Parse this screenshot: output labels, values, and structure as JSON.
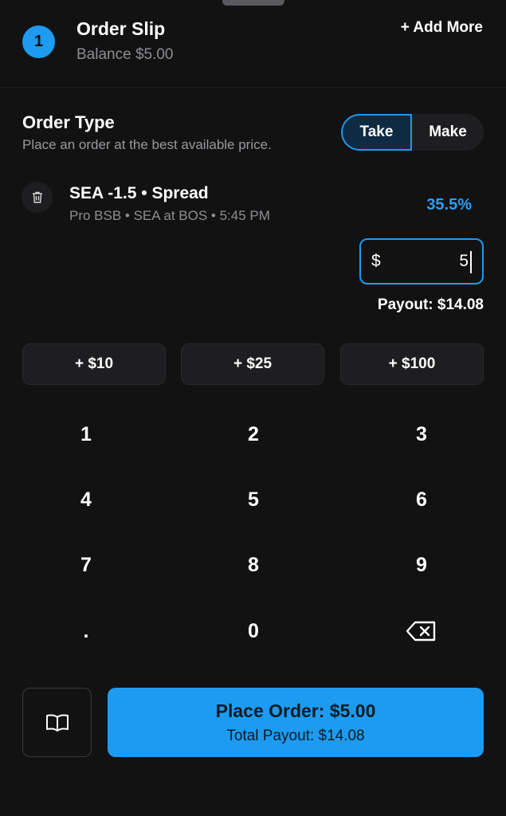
{
  "header": {
    "slip_count": "1",
    "title": "Order Slip",
    "balance": "Balance $5.00",
    "add_more": "+ Add More"
  },
  "order_type": {
    "title": "Order Type",
    "description": "Place an order at the best available price.",
    "options": [
      "Take",
      "Make"
    ],
    "selected": "Take"
  },
  "market": {
    "title": "SEA -1.5 • Spread",
    "subtitle": "Pro BSB • SEA at BOS • 5:45 PM",
    "odds": "35.5%",
    "delete_icon": "trash-icon"
  },
  "amount": {
    "currency": "$",
    "value": "5",
    "payout": "Payout: $14.08"
  },
  "quick_add": [
    "+ $10",
    "+ $25",
    "+ $100"
  ],
  "keypad": {
    "keys": [
      "1",
      "2",
      "3",
      "4",
      "5",
      "6",
      "7",
      "8",
      "9",
      ".",
      "0"
    ],
    "backspace_icon": "backspace-icon"
  },
  "footer": {
    "book_icon": "book-icon",
    "place_order": "Place Order: $5.00",
    "total_payout": "Total Payout: $14.08"
  },
  "colors": {
    "background": "#121213",
    "accent": "#1d9bf0",
    "surface": "#1e1e20",
    "muted_text": "#8e8e93"
  }
}
